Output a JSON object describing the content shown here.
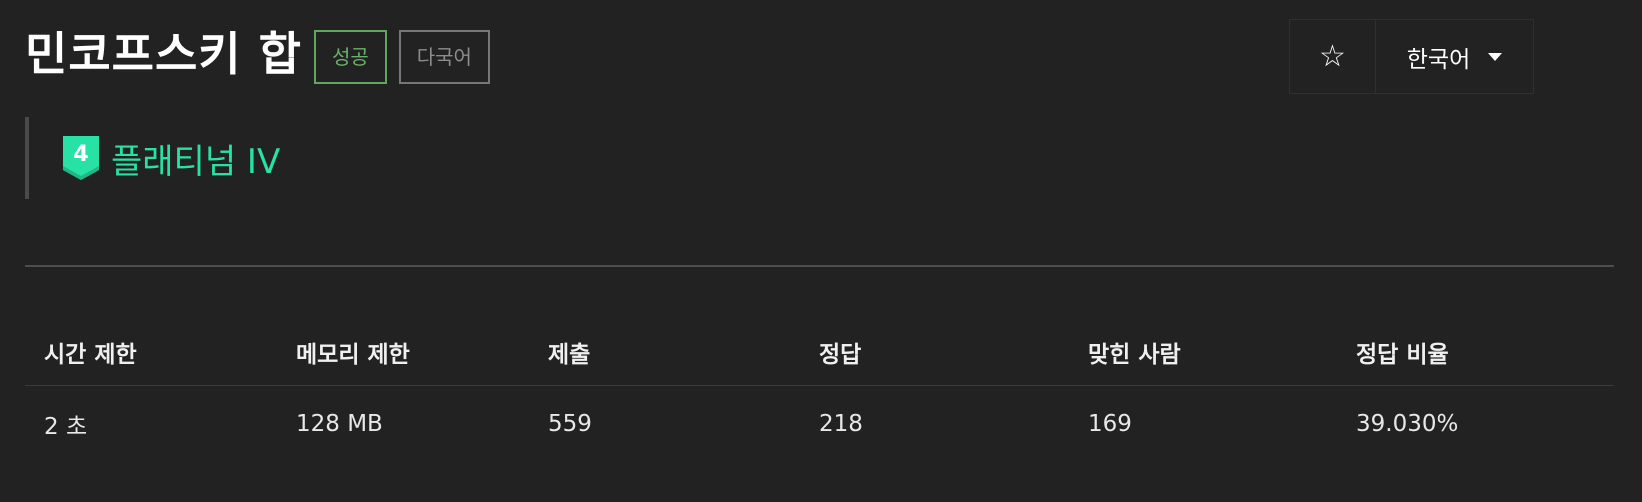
{
  "problem": {
    "title": "민코프스키 합",
    "labels": {
      "success": "성공",
      "multilang": "다국어"
    }
  },
  "controls": {
    "star_glyph": "☆",
    "language": "한국어"
  },
  "tier": {
    "level": "4",
    "name": "플래티넘 IV",
    "color": "#27e2a4"
  },
  "stats": {
    "headers": [
      "시간 제한",
      "메모리 제한",
      "제출",
      "정답",
      "맞힌 사람",
      "정답 비율"
    ],
    "values": [
      "2 초",
      "128 MB",
      "559",
      "218",
      "169",
      "39.030%"
    ]
  },
  "colors": {
    "background": "#222222",
    "success": "#5fa65f",
    "multilang": "#777777"
  }
}
